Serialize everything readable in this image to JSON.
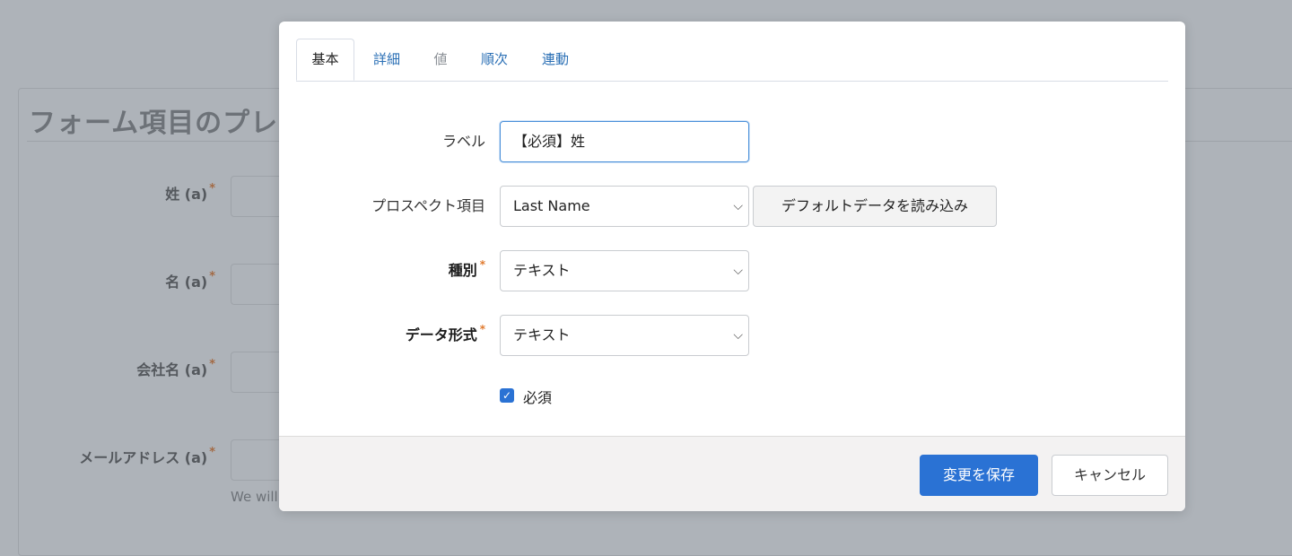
{
  "background": {
    "title": "フォーム項目のプレ",
    "fields": [
      {
        "label": "姓 (a)",
        "required": "*"
      },
      {
        "label": "名 (a)",
        "required": "*"
      },
      {
        "label": "会社名 (a)",
        "required": "*"
      },
      {
        "label": "メールアドレス (a)",
        "required": "*"
      }
    ],
    "help_text": "We will"
  },
  "modal": {
    "tabs": [
      {
        "label": "基本"
      },
      {
        "label": "詳細"
      },
      {
        "label": "値"
      },
      {
        "label": "順次"
      },
      {
        "label": "連動"
      }
    ],
    "form": {
      "label_field": {
        "label": "ラベル",
        "value": "【必須】姓"
      },
      "prospect_field": {
        "label": "プロスペクト項目",
        "value": "Last Name",
        "load_button": "デフォルトデータを読み込み"
      },
      "type_field": {
        "label": "種別",
        "required": "*",
        "value": "テキスト"
      },
      "format_field": {
        "label": "データ形式",
        "required": "*",
        "value": "テキスト"
      },
      "required_checkbox": {
        "label": "必須",
        "checked": true
      }
    },
    "footer": {
      "save_label": "変更を保存",
      "cancel_label": "キャンセル"
    }
  },
  "colors": {
    "accent": "#2a72d4",
    "required": "#e07a2f",
    "overlay": "#aeb3b9"
  }
}
